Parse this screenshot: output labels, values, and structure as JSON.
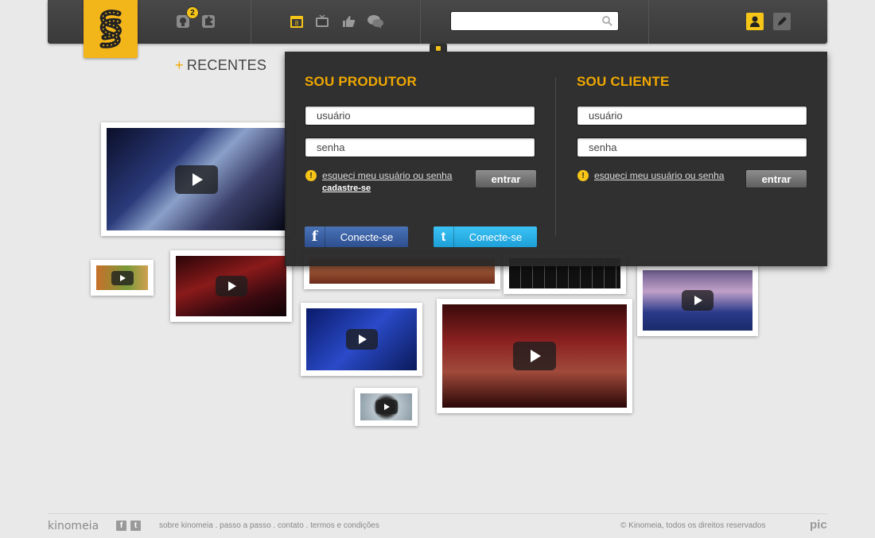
{
  "header": {
    "notification_count": "2",
    "search": {
      "value": "",
      "placeholder": ""
    },
    "icons": [
      "bulb-icon",
      "puzzle-icon",
      "calendar-icon",
      "tv-icon",
      "thumbs-up-icon",
      "chat-bubbles-icon",
      "search-icon",
      "user-icon",
      "pencil-icon"
    ],
    "calendar_day": "8",
    "accent_color": "#f5c518"
  },
  "section": {
    "plus": "+",
    "title": "RECENTES"
  },
  "login": {
    "produtor": {
      "title": "SOU PRODUTOR",
      "username_value": "usuário",
      "password_value": "senha",
      "forgot_link": "esqueci meu usuário ou senha",
      "signup_link": "cadastre-se",
      "submit_label": "entrar"
    },
    "cliente": {
      "title": "SOU CLIENTE",
      "username_value": "usuário",
      "password_value": "senha",
      "forgot_link": "esqueci meu usuário ou senha",
      "submit_label": "entrar"
    },
    "facebook_label": "Conecte-se",
    "twitter_label": "Conecte-se",
    "title_color": "#f0a800"
  },
  "footer": {
    "brand": "kinomeia",
    "links": [
      "sobre kinomeia",
      "passo a passo",
      "contato",
      "termos e condições"
    ],
    "link_separator": " . ",
    "copyright": "© Kinomeia, todos os direitos reservados",
    "credit": "pic"
  }
}
